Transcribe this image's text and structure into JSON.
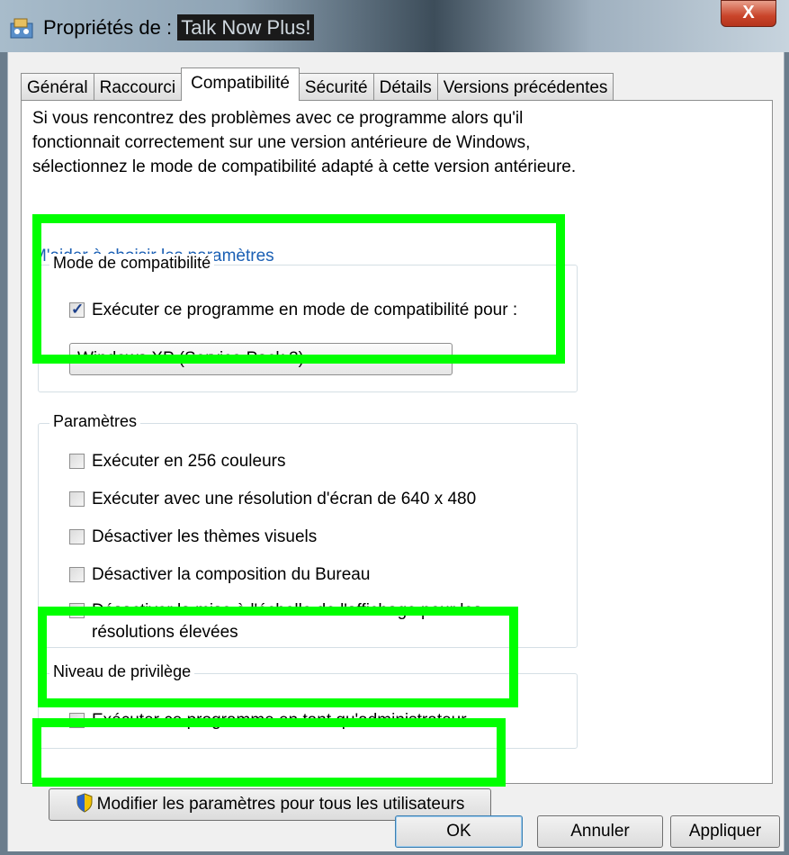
{
  "window": {
    "title_prefix": "Propriétés de : ",
    "title_name": "Talk Now Plus!",
    "close_label": "X"
  },
  "tabs": [
    {
      "label": "Général"
    },
    {
      "label": "Raccourci"
    },
    {
      "label": "Compatibilité"
    },
    {
      "label": "Sécurité"
    },
    {
      "label": "Détails"
    },
    {
      "label": "Versions précédentes"
    }
  ],
  "intro_text": "Si vous rencontrez des problèmes avec ce programme alors qu'il fonctionnait correctement sur une version antérieure de Windows, sélectionnez le mode de compatibilité adapté à cette version antérieure.",
  "help_link": "M'aider à choisir les paramètres",
  "compat_mode": {
    "label": "Mode de compatibilité",
    "checkbox_label": "Exécuter ce programme en mode de compatibilité pour :",
    "checked": true,
    "selected": "Windows XP (Service Pack 3)"
  },
  "settings": {
    "label": "Paramètres",
    "options": [
      {
        "label": "Exécuter en 256 couleurs",
        "checked": false
      },
      {
        "label": "Exécuter avec une résolution d'écran de 640 x 480",
        "checked": false
      },
      {
        "label": "Désactiver les thèmes visuels",
        "checked": false
      },
      {
        "label": "Désactiver la composition du Bureau",
        "checked": false
      },
      {
        "label": "Désactiver la mise à l'échelle de l'affichage pour les résolutions élevées",
        "checked": false
      }
    ]
  },
  "privilege": {
    "label": "Niveau de privilège",
    "checkbox_label": "Exécuter ce programme en tant qu'administrateur",
    "checked": false
  },
  "all_users_button": "Modifier les paramètres pour tous les utilisateurs",
  "buttons": {
    "ok": "OK",
    "cancel": "Annuler",
    "apply": "Appliquer"
  },
  "colors": {
    "highlight": "#00ff00",
    "link": "#1a5fb4"
  }
}
